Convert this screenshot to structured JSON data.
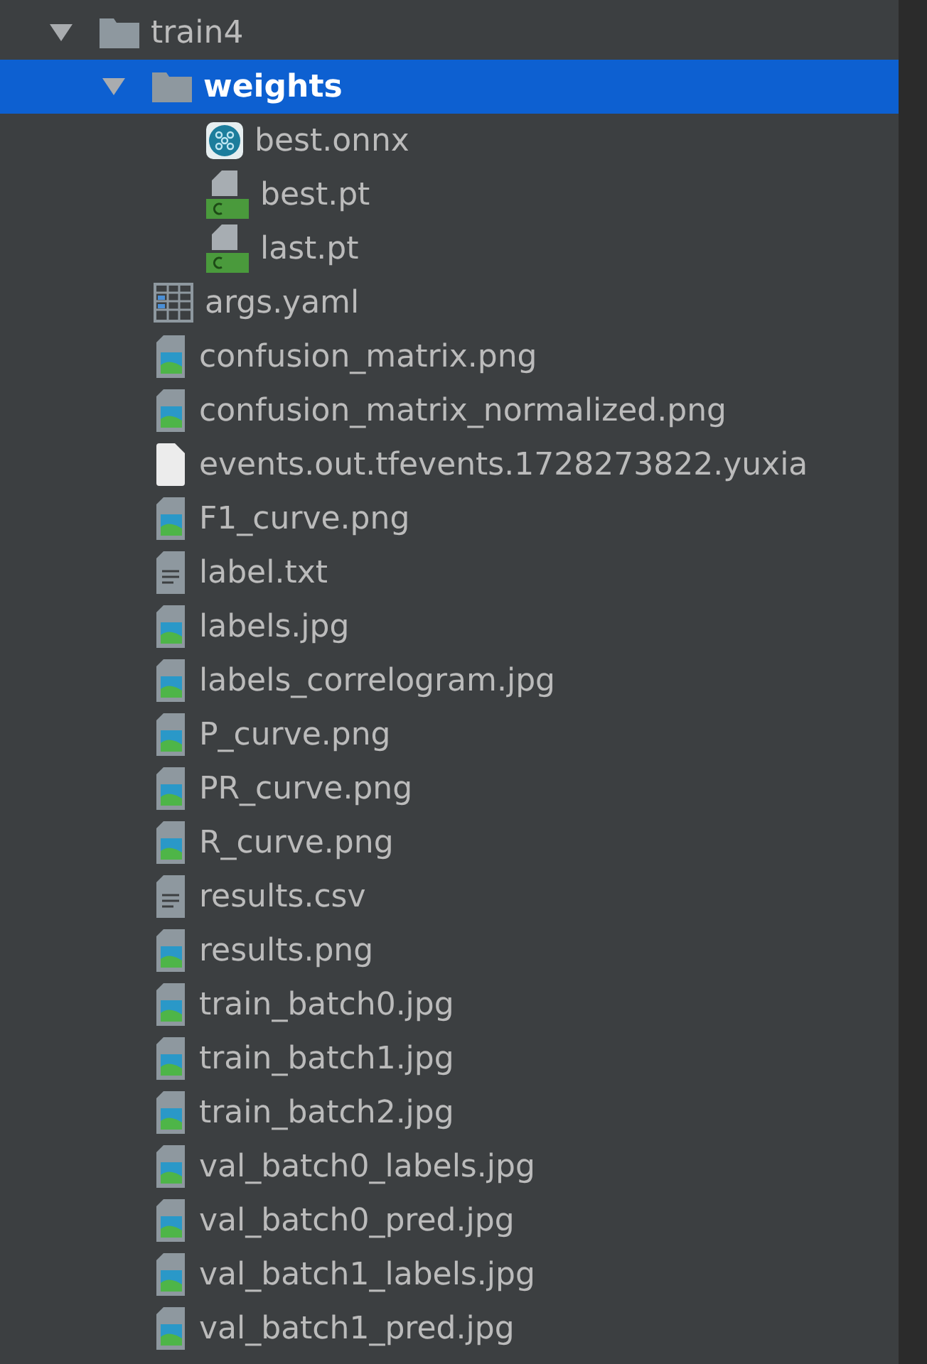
{
  "tree": [
    {
      "name": "train4",
      "kind": "folder",
      "expanded": true,
      "selected": false,
      "children": [
        {
          "name": "weights",
          "kind": "folder",
          "expanded": true,
          "selected": true,
          "children": [
            {
              "name": "best.onnx",
              "kind": "onnx",
              "selected": false
            },
            {
              "name": "best.pt",
              "kind": "pt",
              "selected": false
            },
            {
              "name": "last.pt",
              "kind": "pt",
              "selected": false
            }
          ]
        },
        {
          "name": "args.yaml",
          "kind": "table",
          "selected": false
        },
        {
          "name": "confusion_matrix.png",
          "kind": "image",
          "selected": false
        },
        {
          "name": "confusion_matrix_normalized.png",
          "kind": "image",
          "selected": false
        },
        {
          "name": "events.out.tfevents.1728273822.yuxia",
          "kind": "blank",
          "selected": false
        },
        {
          "name": "F1_curve.png",
          "kind": "image",
          "selected": false
        },
        {
          "name": "label.txt",
          "kind": "text",
          "selected": false
        },
        {
          "name": "labels.jpg",
          "kind": "image",
          "selected": false
        },
        {
          "name": "labels_correlogram.jpg",
          "kind": "image",
          "selected": false
        },
        {
          "name": "P_curve.png",
          "kind": "image",
          "selected": false
        },
        {
          "name": "PR_curve.png",
          "kind": "image",
          "selected": false
        },
        {
          "name": "R_curve.png",
          "kind": "image",
          "selected": false
        },
        {
          "name": "results.csv",
          "kind": "text",
          "selected": false
        },
        {
          "name": "results.png",
          "kind": "image",
          "selected": false
        },
        {
          "name": "train_batch0.jpg",
          "kind": "image",
          "selected": false
        },
        {
          "name": "train_batch1.jpg",
          "kind": "image",
          "selected": false
        },
        {
          "name": "train_batch2.jpg",
          "kind": "image",
          "selected": false
        },
        {
          "name": "val_batch0_labels.jpg",
          "kind": "image",
          "selected": false
        },
        {
          "name": "val_batch0_pred.jpg",
          "kind": "image",
          "selected": false
        },
        {
          "name": "val_batch1_labels.jpg",
          "kind": "image",
          "selected": false
        },
        {
          "name": "val_batch1_pred.jpg",
          "kind": "image",
          "selected": false
        }
      ]
    }
  ]
}
